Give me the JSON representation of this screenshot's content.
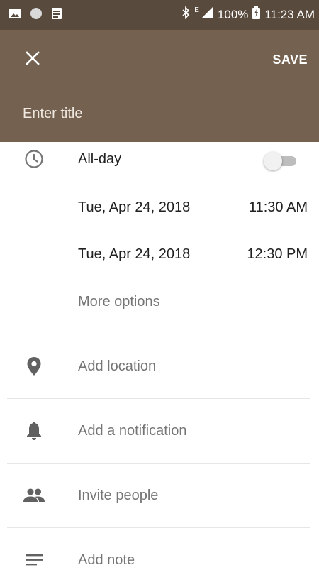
{
  "status_bar": {
    "battery": "100%",
    "time": "11:23 AM",
    "network_label": "E",
    "notification_icons": [
      "image-icon",
      "circle-dot-icon",
      "log-icon"
    ]
  },
  "app_bar": {
    "close_icon": "close-icon",
    "save_label": "SAVE",
    "title_placeholder": "Enter title",
    "background_color": "#74614f"
  },
  "event": {
    "all_day_label": "All-day",
    "all_day_enabled": false,
    "start_date": "Tue, Apr 24, 2018",
    "start_time": "11:30 AM",
    "end_date": "Tue, Apr 24, 2018",
    "end_time": "12:30 PM",
    "more_options_label": "More options"
  },
  "options": {
    "location_label": "Add location",
    "notification_label": "Add a notification",
    "invite_label": "Invite people",
    "note_label": "Add note"
  }
}
